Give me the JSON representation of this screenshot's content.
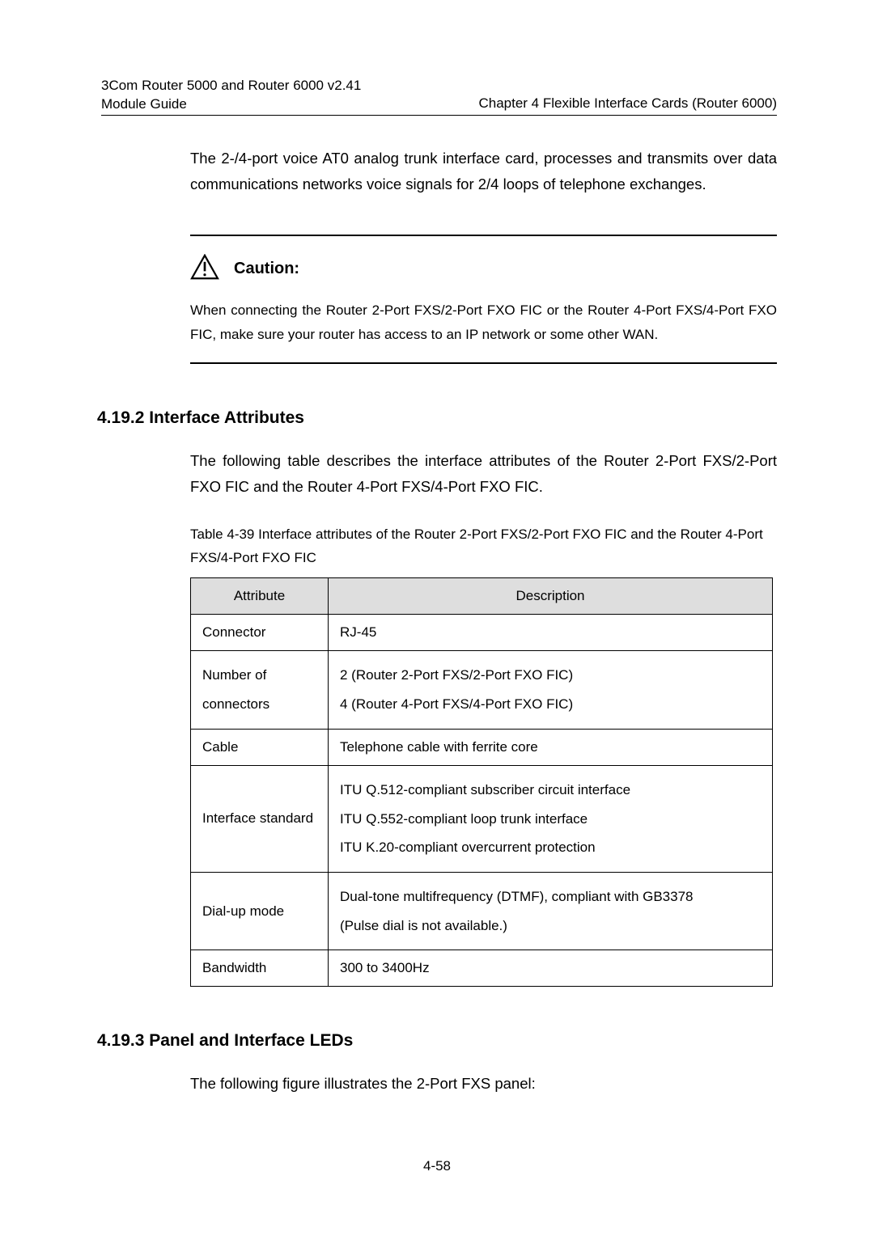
{
  "header": {
    "left_line1": "3Com Router 5000 and Router 6000 v2.41",
    "left_line2": "Module Guide",
    "right": "Chapter 4   Flexible  Interface  Cards  (Router  6000)"
  },
  "intro": "The 2-/4-port voice AT0 analog trunk interface card, processes and transmits over data communications networks voice signals for 2/4 loops of telephone exchanges.",
  "caution": {
    "label": "Caution:",
    "body": "When connecting the Router 2-Port FXS/2-Port FXO FIC or the Router 4-Port FXS/4-Port FXO FIC, make sure your router has access to an IP network or some other WAN."
  },
  "section_4_19_2": {
    "heading": "4.19.2  Interface Attributes",
    "para": "The following table describes the interface attributes of the Router 2-Port FXS/2-Port FXO FIC and the Router 4-Port FXS/4-Port FXO FIC.",
    "table_caption": "Table 4-39 Interface attributes of the Router 2-Port FXS/2-Port FXO FIC and the Router 4-Port FXS/4-Port FXO FIC",
    "table": {
      "head_attr": "Attribute",
      "head_desc": "Description",
      "rows": [
        {
          "attr": "Connector",
          "desc": "RJ-45"
        },
        {
          "attr": "Number of connectors",
          "desc_lines": [
            "2 (Router 2-Port FXS/2-Port FXO FIC)",
            "4 (Router 4-Port FXS/4-Port FXO FIC)"
          ]
        },
        {
          "attr": "Cable",
          "desc": "Telephone cable with ferrite core"
        },
        {
          "attr": "Interface standard",
          "desc_lines": [
            "ITU Q.512-compliant subscriber circuit interface",
            "ITU Q.552-compliant loop trunk interface",
            "ITU K.20-compliant overcurrent protection"
          ]
        },
        {
          "attr": "Dial-up mode",
          "desc_lines": [
            "Dual-tone multifrequency (DTMF), compliant with GB3378",
            "(Pulse dial is not available.)"
          ]
        },
        {
          "attr": "Bandwidth",
          "desc": "300 to 3400Hz"
        }
      ]
    }
  },
  "section_4_19_3": {
    "heading": "4.19.3  Panel and Interface LEDs",
    "para": "The following figure illustrates the 2-Port FXS panel:"
  },
  "page_number": "4-58"
}
